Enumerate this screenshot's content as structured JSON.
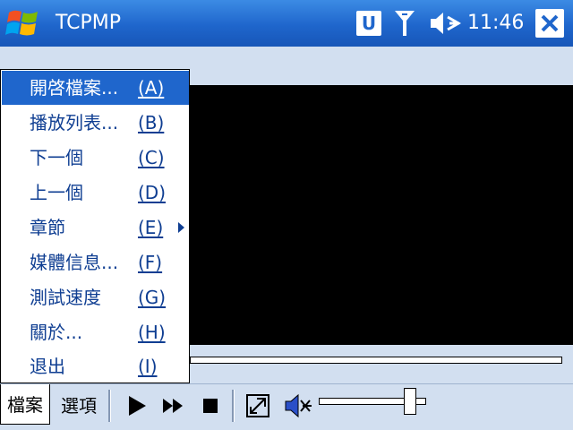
{
  "title_bar": {
    "app_title": "TCPMP",
    "badge_letter": "U",
    "clock": "11:46",
    "icons": [
      "windows-start-icon",
      "antenna-signal-icon",
      "speaker-icon",
      "close-icon"
    ]
  },
  "file_menu": {
    "items": [
      {
        "label": "開啓檔案...",
        "key": "(A)",
        "selected": true
      },
      {
        "label": "播放列表...",
        "key": "(B)"
      },
      {
        "label": "下一個",
        "key": "(C)"
      },
      {
        "label": "上一個",
        "key": "(D)"
      },
      {
        "label": "章節",
        "key": "(E)",
        "has_submenu": true
      },
      {
        "label": "媒體信息...",
        "key": "(F)"
      },
      {
        "label": "測試速度",
        "key": "(G)"
      },
      {
        "label": "關於...",
        "key": "(H)"
      },
      {
        "label": "退出",
        "key": "(I)"
      }
    ]
  },
  "toolbar": {
    "file_menu_label": "檔案",
    "options_menu_label": "選項",
    "icons": [
      "play-icon",
      "fast-forward-icon",
      "stop-icon",
      "fullscreen-icon",
      "volume-icon"
    ],
    "volume_level": 0.85
  },
  "colors": {
    "title_bar": "#1f66cc",
    "menu_text": "#0f3e92",
    "selection": "#1f66cc",
    "background": "#d2dff0",
    "video": "#000000"
  }
}
